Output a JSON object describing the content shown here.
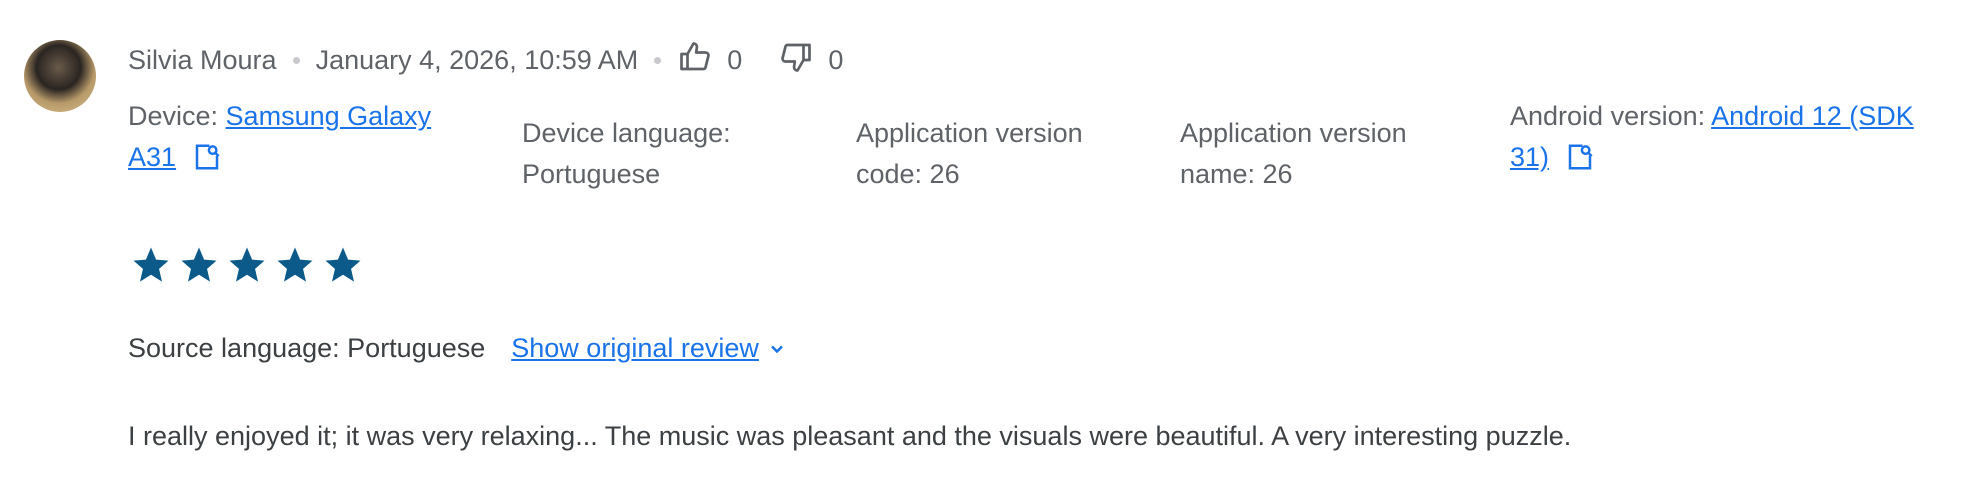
{
  "review": {
    "author": "Silvia Moura",
    "datetime": "January 4, 2026, 10:59 AM",
    "thumbs_up_count": "0",
    "thumbs_down_count": "0",
    "device_label": "Device: ",
    "device_link": "Samsung Galaxy A31",
    "device_language": "Device language: Portuguese",
    "app_version_code": "Application version code: 26",
    "app_version_name": "Application version name: 26",
    "android_label": "Android version: ",
    "android_link": "Android 12 (SDK 31)",
    "rating": 5,
    "source_language": "Source language: Portuguese",
    "show_original_label": "Show original review",
    "text": "I really enjoyed it; it was very relaxing... The music was pleasant and the visuals were beautiful. A very interesting puzzle."
  },
  "icons": {
    "thumbs_up": "thumb-up-icon",
    "thumbs_down": "thumb-down-icon",
    "external": "open-in-new-icon",
    "star": "star-icon",
    "chevron": "chevron-down-icon"
  },
  "colors": {
    "link": "#1a73e8",
    "star": "#0b5a8a",
    "muted_text": "#5f6368",
    "body_text": "#3c4043"
  }
}
